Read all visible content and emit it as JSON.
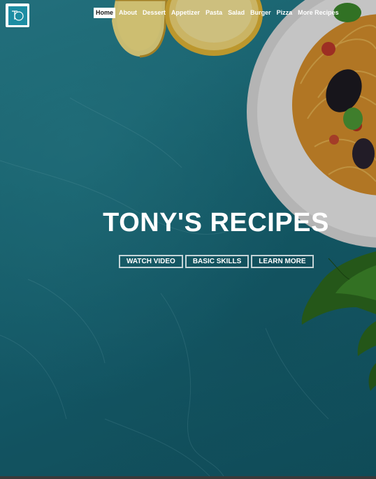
{
  "logo": {
    "alt": "Tony's logo",
    "monogram": "TO"
  },
  "nav": {
    "items": [
      {
        "label": "Home",
        "active": true
      },
      {
        "label": "About"
      },
      {
        "label": "Dessert"
      },
      {
        "label": "Appetizer"
      },
      {
        "label": "Pasta"
      },
      {
        "label": "Salad"
      },
      {
        "label": "Burger"
      },
      {
        "label": "Pizza"
      },
      {
        "label": "More Recipes"
      }
    ]
  },
  "hero": {
    "title": "TONY'S RECIPES",
    "buttons": [
      "WATCH VIDEO",
      "BASIC SKILLS",
      "LEARN MORE"
    ]
  },
  "colors": {
    "background": "#1f6f7d",
    "accent_logo": "#1d8da3",
    "text": "#ffffff"
  }
}
